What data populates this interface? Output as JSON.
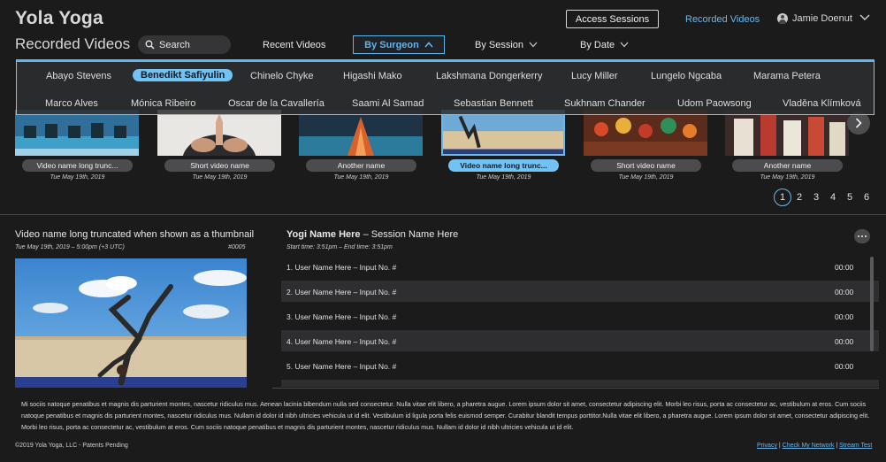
{
  "header": {
    "logo": "Yola Yoga",
    "page_title": "Recorded Videos",
    "search_placeholder": "Search",
    "nav": {
      "recent": "Recent Videos",
      "by_surgeon": "By Surgeon",
      "by_session": "By Session",
      "by_date": "By Date"
    },
    "access_sessions": "Access Sessions",
    "recorded_videos_link": "Recorded Videos",
    "user_name": "Jamie Doenut"
  },
  "surgeon_dropdown": {
    "selected": "Benedikt Safiyulin",
    "row1": [
      "Abayo Stevens",
      "Benedikt Safiyulin",
      "Chinelo Chyke",
      "Higashi Mako",
      "Lakshmana Dongerkerry",
      "Lucy Miller",
      "Lungelo Ngcaba",
      "Marama Petera"
    ],
    "row2": [
      "Marco Alves",
      "Mónica Ribeiro",
      "Oscar de la Cavallería",
      "Saami Al Samad",
      "Sebastian Bennett",
      "Sukhnam Chander",
      "Udom Paowsong",
      "Vladěna Klímková"
    ]
  },
  "thumbnails": [
    {
      "label": "Video name long trunc...",
      "date": "Tue May 19th, 2019",
      "icon": "gym-thumbnail"
    },
    {
      "label": "Short video name",
      "date": "Tue May 19th, 2019",
      "icon": "yoga-hands-thumbnail"
    },
    {
      "label": "Another name",
      "date": "Tue May 19th, 2019",
      "icon": "abstract-orange-thumbnail"
    },
    {
      "label": "Video name long trunc...",
      "date": "Tue May 19th, 2019",
      "icon": "handstand-thumbnail"
    },
    {
      "label": "Short video name",
      "date": "Tue May 19th, 2019",
      "icon": "crowd-thumbnail"
    },
    {
      "label": "Another name",
      "date": "Tue May 19th, 2019",
      "icon": "festival-thumbnail"
    }
  ],
  "pagination": [
    "1",
    "2",
    "3",
    "4",
    "5",
    "6"
  ],
  "current_page": "1",
  "video": {
    "title": "Video name long truncated when shown as a thumbnail",
    "meta": "Tue May 19th, 2019 – 5:00pm (+3 UTC)",
    "id": "#0005"
  },
  "session": {
    "yogi": "Yogi Name Here",
    "name": " – Session Name Here",
    "times": "Start time: 3:51pm  –  End time: 3:51pm",
    "rows": [
      {
        "label": "1.  User Name Here – Input No. #",
        "time": "00:00"
      },
      {
        "label": "2.  User Name Here – Input No. #",
        "time": "00:00"
      },
      {
        "label": "3.  User Name Here – Input No. #",
        "time": "00:00"
      },
      {
        "label": "4.  User Name Here – Input No. #",
        "time": "00:00"
      },
      {
        "label": "5.  User Name Here – Input No. #",
        "time": "00:00"
      }
    ]
  },
  "footer": {
    "text": "Mi sociis natoque penatibus et magnis dis parturient montes, nascetur ridiculus mus. Aenean lacinia bibendum nulla sed consectetur. Nulla vitae elit libero, a pharetra augue. Lorem ipsum dolor sit amet, consectetur adipiscing elit. Morbi leo risus, porta ac consectetur ac, vestibulum at eros. Cum sociis natoque penatibus et magnis dis parturient montes, nascetur ridiculus mus. Nullam id dolor id nibh ultricies vehicula ut id elit. Vestibulum id ligula porta felis euismod semper. Curabitur blandit tempus porttitor.Nulla vitae elit libero, a pharetra augue. Lorem ipsum dolor sit amet, consectetur adipiscing elit. Morbi leo risus, porta ac consectetur ac, vestibulum at eros. Cum sociis natoque penatibus et magnis dis parturient montes, nascetur ridiculus mus. Nullam id dolor id nibh ultricies vehicula ut id elit.",
    "copyright": "©2019 Yola Yoga, LLC - Patents Pending",
    "links": {
      "privacy": "Privacy",
      "network": "Check My Network",
      "stream": "Stream Test"
    }
  },
  "colors": {
    "accent": "#5fb5ec",
    "selected_fill": "#72c2f4",
    "background": "#1b1b1c"
  }
}
